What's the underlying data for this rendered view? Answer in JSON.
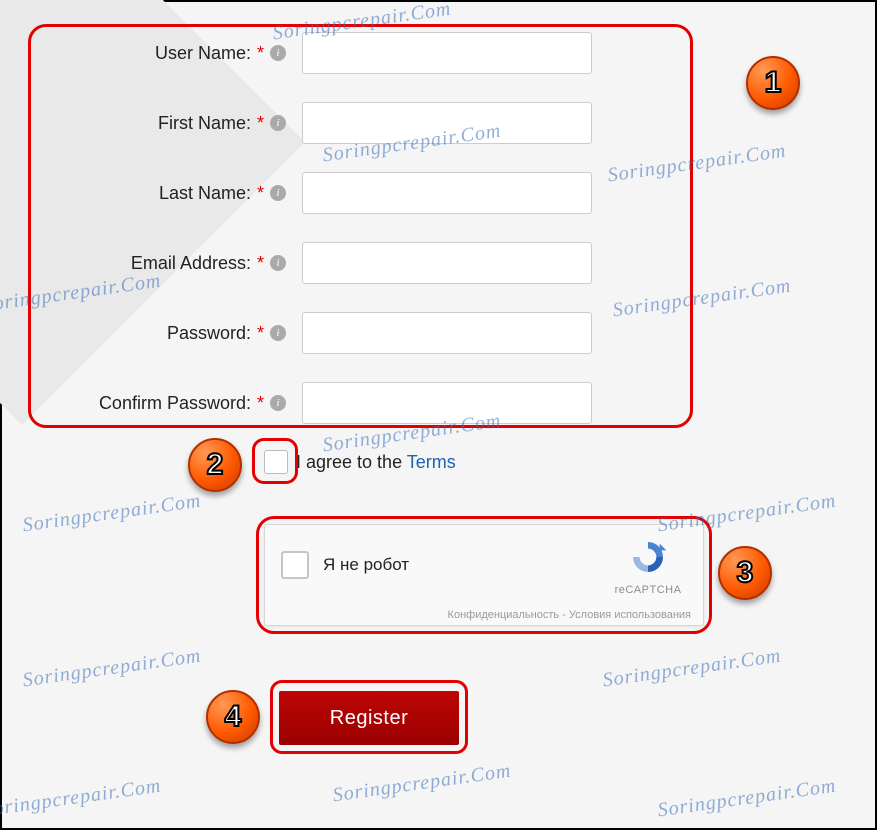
{
  "watermark": "Soringpcrepair.Com",
  "form": {
    "fields": [
      {
        "label": "User Name:",
        "value": ""
      },
      {
        "label": "First Name:",
        "value": ""
      },
      {
        "label": "Last Name:",
        "value": ""
      },
      {
        "label": "Email Address:",
        "value": ""
      },
      {
        "label": "Password:",
        "value": ""
      },
      {
        "label": "Confirm Password:",
        "value": ""
      }
    ],
    "required_marker": "*"
  },
  "terms": {
    "prefix": "I agree to the ",
    "link": "Terms"
  },
  "recaptcha": {
    "label": "Я не робот",
    "brand": "reCAPTCHA",
    "links": "Конфиденциальность - Условия использования"
  },
  "register_label": "Register",
  "annotations": {
    "badge1": "1",
    "badge2": "2",
    "badge3": "3",
    "badge4": "4"
  }
}
